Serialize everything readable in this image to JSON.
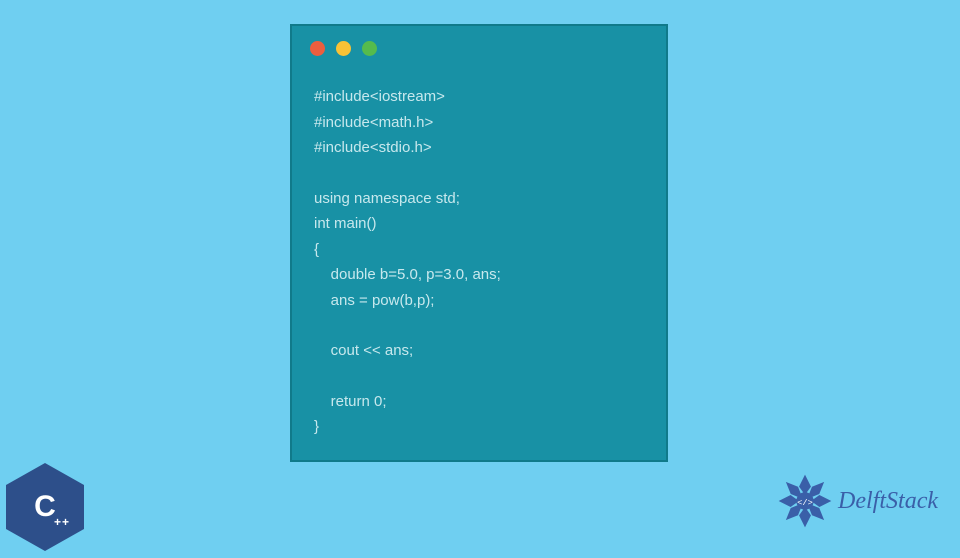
{
  "code": {
    "lines": [
      "#include<iostream>",
      "#include<math.h>",
      "#include<stdio.h>",
      "",
      "using namespace std;",
      "int main()",
      "{",
      "    double b=5.0, p=3.0, ans;",
      "    ans = pow(b,p);",
      "",
      "    cout << ans;",
      "",
      "    return 0;",
      "}"
    ]
  },
  "cpp_logo": {
    "letter": "C",
    "plus": "++"
  },
  "delftstack": {
    "text": "DelftStack"
  },
  "colors": {
    "background": "#6fcff1",
    "window": "#1891a5",
    "dot_red": "#ec5e3f",
    "dot_yellow": "#f9c235",
    "dot_green": "#55bb4d",
    "logo_blue": "#3a5fa8"
  }
}
